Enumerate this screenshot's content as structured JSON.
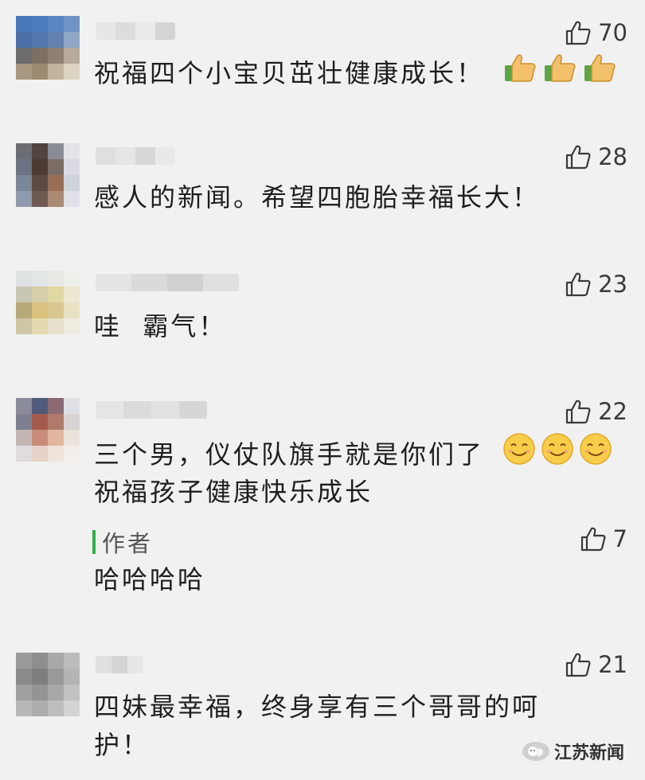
{
  "comments": [
    {
      "likes": "70",
      "text": "祝福四个小宝贝茁壮健康成长！",
      "emojis": [
        "thumbs-up-emoji",
        "thumbs-up-emoji",
        "thumbs-up-emoji"
      ],
      "avatar_colors": [
        "#4a78b8",
        "#4d7dbf",
        "#5a86c4",
        "#6f93c6",
        "#4a6fa6",
        "#5278ad",
        "#6281b0",
        "#90a6c6",
        "#6c6c6c",
        "#7c6f64",
        "#8e8172",
        "#b8aa98",
        "#a7977f",
        "#9d8a70",
        "#c2b39c",
        "#dcd3c2"
      ],
      "name_colors": [
        "#e6e6e6",
        "#d9d9d9",
        "#e9e9e9",
        "#cfcfcf"
      ]
    },
    {
      "likes": "28",
      "text": "感人的新闻。希望四胞胎幸福长大！",
      "emojis": [],
      "avatar_colors": [
        "#6b6d73",
        "#51433f",
        "#8a8c95",
        "#e2e4ea",
        "#6c7484",
        "#4d3a33",
        "#7c6c66",
        "#d9dbe2",
        "#7a8799",
        "#5d4a42",
        "#9a6d57",
        "#ced3dc",
        "#8f9aae",
        "#6e5a50",
        "#aa8a74",
        "#dfe1e6"
      ],
      "name_colors": [
        "#dcdcdc",
        "#e5e5e5",
        "#d3d3d3",
        "#e8e8e8"
      ]
    },
    {
      "likes": "23",
      "text": "哇  霸气！",
      "emojis": [],
      "avatar_colors": [
        "#dfe2e3",
        "#e3e6e6",
        "#e8e9e4",
        "#eeeeea",
        "#c9c6b3",
        "#d4cfa8",
        "#e0d8a2",
        "#ece7d0",
        "#b8a979",
        "#d8c27e",
        "#d9c790",
        "#e8e1c4",
        "#cfc6a6",
        "#e4d9b0",
        "#e6e0cc",
        "#efece2"
      ],
      "name_colors": [
        "#e2e2e2",
        "#d6d6d6",
        "#cbcbcb",
        "#dedede"
      ]
    },
    {
      "likes": "22",
      "text_lines": [
        "三个男，仪仗队旗手就是你们了",
        "祝福孩子健康快乐成长"
      ],
      "emojis": [
        "smile-emoji",
        "smile-emoji",
        "smile-emoji"
      ],
      "avatar_colors": [
        "#8a8c9c",
        "#505a7a",
        "#8c6a73",
        "#dfdfe6",
        "#7d8090",
        "#a45b4e",
        "#b07a6a",
        "#d9d2d2",
        "#c2b7b4",
        "#c88d7a",
        "#e0b69e",
        "#ece2dc",
        "#dedcde",
        "#e6d2c8",
        "#efe3da",
        "#f2eeea"
      ],
      "name_colors": [
        "#e4e4e4",
        "#d8d8d8",
        "#e0e0e0",
        "#d2d2d2"
      ],
      "reply": {
        "author_label": "作者",
        "likes": "7",
        "text": "哈哈哈哈"
      }
    },
    {
      "likes": "21",
      "text_lines": [
        "四妹最幸福，终身享有三个哥哥的呵",
        "护！"
      ],
      "emojis": [],
      "avatar_colors": [
        "#9a9a9a",
        "#8e8e8e",
        "#a9a9a9",
        "#bcbcbc",
        "#8a8a8a",
        "#7e7e7e",
        "#999999",
        "#b4b4b4",
        "#a0a0a0",
        "#949494",
        "#a8a8a8",
        "#c2c2c2",
        "#b8b8b8",
        "#adadad",
        "#bdbdbd",
        "#d3d3d3"
      ],
      "name_colors": [
        "#dedede",
        "#cfcfcf",
        "#e6e6e6"
      ]
    }
  ],
  "watermark": {
    "icon": "wechat-official-account-icon",
    "text": "江苏新闻"
  },
  "colors": {
    "background": "#f1f1f1",
    "reply_bar": "#2fb04a"
  }
}
